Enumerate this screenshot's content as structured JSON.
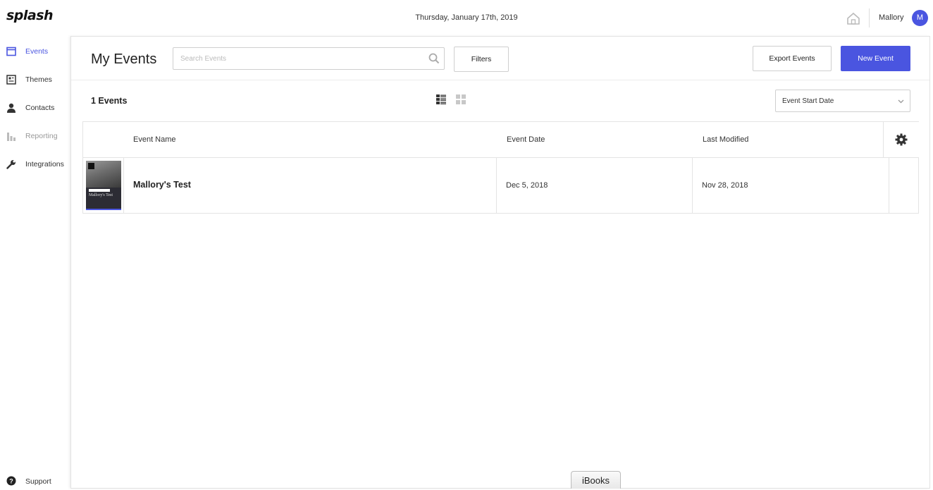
{
  "app": {
    "logo": "splash"
  },
  "topbar": {
    "date": "Thursday, January 17th, 2019",
    "username": "Mallory",
    "avatar_initial": "M"
  },
  "sidebar": {
    "items": [
      {
        "label": "Events",
        "icon": "calendar-icon",
        "state": "active"
      },
      {
        "label": "Themes",
        "icon": "theme-icon",
        "state": "normal"
      },
      {
        "label": "Contacts",
        "icon": "person-icon",
        "state": "normal"
      },
      {
        "label": "Reporting",
        "icon": "bar-chart-icon",
        "state": "disabled"
      },
      {
        "label": "Integrations",
        "icon": "wrench-icon",
        "state": "normal"
      }
    ],
    "support": {
      "label": "Support",
      "icon": "question-circle-icon"
    }
  },
  "main": {
    "title": "My Events",
    "search": {
      "placeholder": "Search Events",
      "value": ""
    },
    "filters_label": "Filters",
    "export_label": "Export Events",
    "new_event_label": "New Event",
    "count_label": "1 Events",
    "sort": {
      "selected": "Event Start Date"
    },
    "table": {
      "columns": {
        "name": "Event Name",
        "date": "Event Date",
        "modified": "Last Modified"
      },
      "rows": [
        {
          "name": "Mallory's Test",
          "event_date": "Dec 5, 2018",
          "last_modified": "Nov 28, 2018",
          "thumb_title": "Mallory's Test"
        }
      ]
    }
  },
  "dock": {
    "tooltip": "iBooks"
  },
  "colors": {
    "accent": "#4a55e0"
  }
}
